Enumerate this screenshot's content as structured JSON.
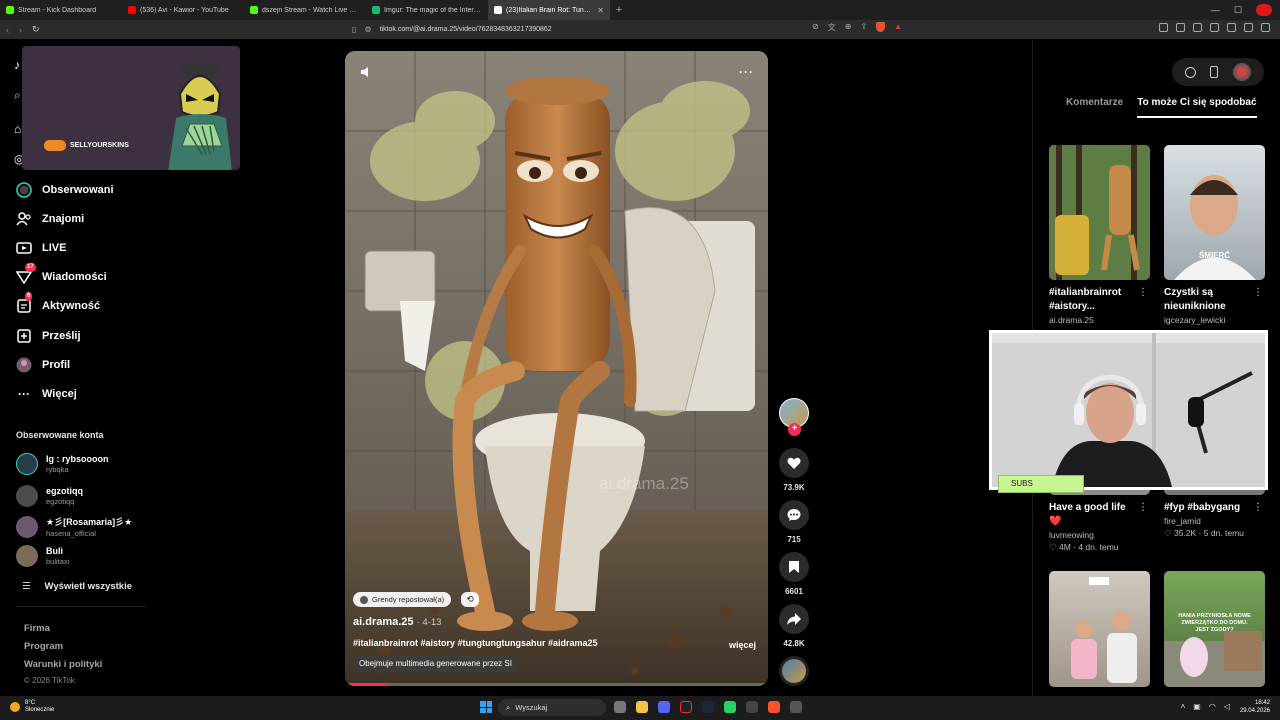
{
  "browser": {
    "tabs": [
      {
        "label": "Stream - Kick Dashboard",
        "color": "#53fc18"
      },
      {
        "label": "(536) Avi - Kawior - YouTube",
        "color": "#ff0000"
      },
      {
        "label": "dszejn Stream - Watch Live on Kick",
        "color": "#53fc18"
      },
      {
        "label": "Imgur: The magic of the Internet",
        "color": "#1bb76e"
      },
      {
        "label": "(23)Italian Brain Rot: Tung Tu",
        "color": "#ffffff"
      }
    ],
    "url": "tiktok.com/@ai.drama.25/video/7628348363217390862"
  },
  "promo": {
    "brand": "SELLYOURSKINS"
  },
  "nav": [
    {
      "label": "Obserwowani",
      "icon": "following-icon"
    },
    {
      "label": "Znajomi",
      "icon": "friends-icon"
    },
    {
      "label": "LIVE",
      "icon": "live-icon"
    },
    {
      "label": "Wiadomości",
      "icon": "messages-icon",
      "count": "17"
    },
    {
      "label": "Aktywność",
      "icon": "activity-icon",
      "count": "6"
    },
    {
      "label": "Prześlij",
      "icon": "upload-icon"
    },
    {
      "label": "Profil",
      "icon": "profile-icon"
    },
    {
      "label": "Więcej",
      "icon": "more-icon"
    }
  ],
  "followed": {
    "title": "Obserwowane konta",
    "accounts": [
      {
        "name": "Ig : rybsoooon",
        "handle": "rybqka",
        "color": "#2a3b4a"
      },
      {
        "name": "egzotiqq",
        "handle": "egzotiqq",
        "color": "#4b4b4b"
      },
      {
        "name": "★彡[Rosamaria]彡★",
        "handle": "hasena_official",
        "color": "#6b5a6e"
      },
      {
        "name": "Buli",
        "handle": "bulitaxi",
        "color": "#7a6a58"
      }
    ],
    "show_all": "Wyświetl wszystkie"
  },
  "footer": {
    "links": [
      "Firma",
      "Program",
      "Warunki i polityki"
    ],
    "copyright": "© 2026 TikTok"
  },
  "video": {
    "watermark": "ai.drama.25",
    "repost": "Grendy repostował(a)",
    "author": "ai.drama.25",
    "date": "4-13",
    "hashtags": "#italianbrainrot #aistory #tungtungtungsahur #aidrama25",
    "more": "więcej",
    "ai_label": "Obejmuje multimedia generowane przez SI",
    "progress": 0.1
  },
  "actions": {
    "likes": "73.9K",
    "comments": "715",
    "saves": "6601",
    "shares": "42.8K"
  },
  "panel": {
    "tabs": [
      "Komentarze",
      "To może Ci się spodobać"
    ],
    "cards": [
      {
        "title": "#italianbrainrot #aistory...",
        "user": "ai.drama.25",
        "meta": ""
      },
      {
        "title": "Czystki są nieuniknione",
        "user": "igcezary_lewicki",
        "meta": "",
        "caption": "ŚMIERĆ"
      },
      {
        "title": "Have a good life ❤️",
        "user": "luvmeowing",
        "meta": "♡ 4M · 4 dn. temu"
      },
      {
        "title": "#fyp #babygang",
        "user": "fire_jamid",
        "meta": "♡ 35.2K · 5 dn. temu"
      }
    ],
    "card_bottom_caption": "HANIA PRZYNIOSŁA NOWE ZWIERZĄTKO DO DOMU. JEST ZGODY?"
  },
  "overlay": {
    "subs_label": "SUBS"
  },
  "taskbar": {
    "temp": "8°C",
    "weather": "Słonecznie",
    "search": "Wyszukaj",
    "time": "18:42",
    "date": "29.04.2026"
  }
}
